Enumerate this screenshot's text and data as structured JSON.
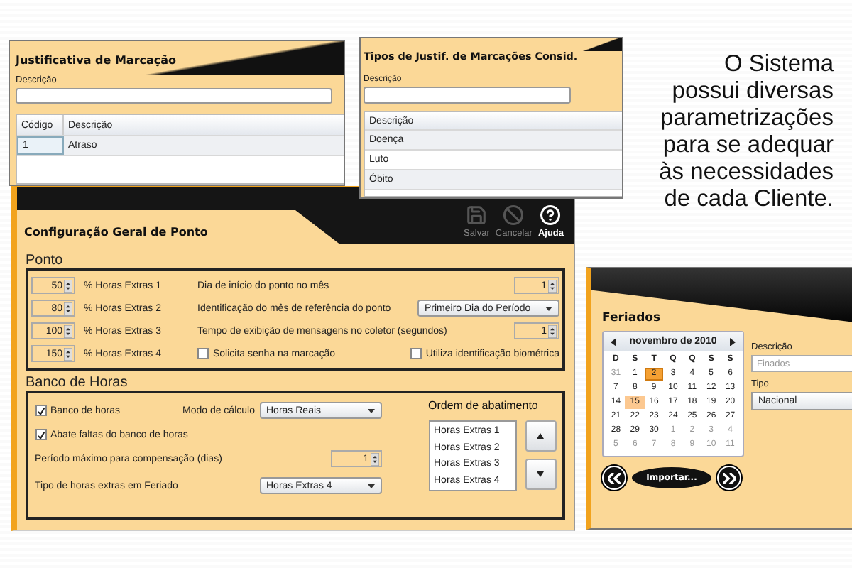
{
  "justificativa_window": {
    "title": "Justificativa de Marcação",
    "field_label": "Descrição",
    "table": {
      "columns": [
        "Código",
        "Descrição"
      ],
      "rows": [
        {
          "cells": [
            "1",
            "Atraso"
          ],
          "selected": true
        }
      ]
    }
  },
  "tipos_window": {
    "title": "Tipos de Justif. de Marcações Consid.",
    "field_label": "Descrição",
    "table": {
      "columns": [
        "Descrição"
      ],
      "rows": [
        {
          "cells": [
            "Doença"
          ]
        },
        {
          "cells": [
            "Luto"
          ]
        },
        {
          "cells": [
            "Óbito"
          ]
        }
      ]
    }
  },
  "slide_text": "O Sistema\npossui diversas\nparametrizações\npara se adequar\nàs necessidades\nde cada Cliente.",
  "config_window": {
    "title": "Configuração Geral de Ponto",
    "toolbar": [
      {
        "label": "Salvar",
        "disabled": true
      },
      {
        "label": "Cancelar",
        "disabled": true
      },
      {
        "label": "Ajuda",
        "disabled": false
      }
    ],
    "ponto": {
      "title": "Ponto",
      "rows": [
        {
          "percent": "50",
          "percent_label": "% Horas Extras 1",
          "setting": {
            "kind": "spinner",
            "label": "Dia de início do ponto no mês",
            "value": "1"
          }
        },
        {
          "percent": "80",
          "percent_label": "% Horas Extras 2",
          "setting": {
            "kind": "dropdown",
            "label": "Identificação do mês de referência do ponto",
            "value": "Primeiro Dia do Período"
          }
        },
        {
          "percent": "100",
          "percent_label": "% Horas Extras 3",
          "setting": {
            "kind": "spinner",
            "label": "Tempo de exibição de mensagens no coletor (segundos)",
            "value": "1"
          }
        },
        {
          "percent": "150",
          "percent_label": "% Horas Extras 4",
          "setting": {
            "kind": "checkboxes",
            "items": [
              {
                "label": "Solicita senha na marcação",
                "checked": false
              },
              {
                "label": "Utiliza identificação biométrica",
                "checked": false
              }
            ]
          }
        }
      ]
    },
    "banco": {
      "title": "Banco de Horas",
      "banco_check": {
        "label": "Banco de horas",
        "checked": true
      },
      "modo": {
        "label": "Modo de cálculo",
        "value": "Horas Reais"
      },
      "abate_check": {
        "label": "Abate faltas do banco de horas",
        "checked": true
      },
      "periodo": {
        "label": "Período máximo para compensação (dias)",
        "value": "1"
      },
      "tipo": {
        "label": "Tipo de horas extras em Feriado",
        "value": "Horas Extras 4"
      },
      "ordem": {
        "title": "Ordem de abatimento",
        "items": [
          "Horas Extras 1",
          "Horas Extras 2",
          "Horas Extras 3",
          "Horas Extras 4"
        ]
      }
    }
  },
  "feriados_window": {
    "title": "Feriados",
    "calendar": {
      "month": "novembro de 2010",
      "weekdays": [
        "D",
        "S",
        "T",
        "Q",
        "Q",
        "S",
        "S"
      ],
      "days": [
        {
          "label": "31",
          "other_month": true,
          "selected": false,
          "marked": false
        },
        {
          "label": "1",
          "other_month": false,
          "selected": false,
          "marked": false
        },
        {
          "label": "2",
          "other_month": false,
          "selected": true,
          "marked": false
        },
        {
          "label": "3",
          "other_month": false,
          "selected": false,
          "marked": false
        },
        {
          "label": "4",
          "other_month": false,
          "selected": false,
          "marked": false
        },
        {
          "label": "5",
          "other_month": false,
          "selected": false,
          "marked": false
        },
        {
          "label": "6",
          "other_month": false,
          "selected": false,
          "marked": false
        },
        {
          "label": "7",
          "other_month": false,
          "selected": false,
          "marked": false
        },
        {
          "label": "8",
          "other_month": false,
          "selected": false,
          "marked": false
        },
        {
          "label": "9",
          "other_month": false,
          "selected": false,
          "marked": false
        },
        {
          "label": "10",
          "other_month": false,
          "selected": false,
          "marked": false
        },
        {
          "label": "11",
          "other_month": false,
          "selected": false,
          "marked": false
        },
        {
          "label": "12",
          "other_month": false,
          "selected": false,
          "marked": false
        },
        {
          "label": "13",
          "other_month": false,
          "selected": false,
          "marked": false
        },
        {
          "label": "14",
          "other_month": false,
          "selected": false,
          "marked": false
        },
        {
          "label": "15",
          "other_month": false,
          "selected": false,
          "marked": true
        },
        {
          "label": "16",
          "other_month": false,
          "selected": false,
          "marked": false
        },
        {
          "label": "17",
          "other_month": false,
          "selected": false,
          "marked": false
        },
        {
          "label": "18",
          "other_month": false,
          "selected": false,
          "marked": false
        },
        {
          "label": "19",
          "other_month": false,
          "selected": false,
          "marked": false
        },
        {
          "label": "20",
          "other_month": false,
          "selected": false,
          "marked": false
        },
        {
          "label": "21",
          "other_month": false,
          "selected": false,
          "marked": false
        },
        {
          "label": "22",
          "other_month": false,
          "selected": false,
          "marked": false
        },
        {
          "label": "23",
          "other_month": false,
          "selected": false,
          "marked": false
        },
        {
          "label": "24",
          "other_month": false,
          "selected": false,
          "marked": false
        },
        {
          "label": "25",
          "other_month": false,
          "selected": false,
          "marked": false
        },
        {
          "label": "26",
          "other_month": false,
          "selected": false,
          "marked": false
        },
        {
          "label": "27",
          "other_month": false,
          "selected": false,
          "marked": false
        },
        {
          "label": "28",
          "other_month": false,
          "selected": false,
          "marked": false
        },
        {
          "label": "29",
          "other_month": false,
          "selected": false,
          "marked": false
        },
        {
          "label": "30",
          "other_month": false,
          "selected": false,
          "marked": false
        },
        {
          "label": "1",
          "other_month": true,
          "selected": false,
          "marked": false
        },
        {
          "label": "2",
          "other_month": true,
          "selected": false,
          "marked": false
        },
        {
          "label": "3",
          "other_month": true,
          "selected": false,
          "marked": false
        },
        {
          "label": "4",
          "other_month": true,
          "selected": false,
          "marked": false
        },
        {
          "label": "5",
          "other_month": true,
          "selected": false,
          "marked": false
        },
        {
          "label": "6",
          "other_month": true,
          "selected": false,
          "marked": false
        },
        {
          "label": "7",
          "other_month": true,
          "selected": false,
          "marked": false
        },
        {
          "label": "8",
          "other_month": true,
          "selected": false,
          "marked": false
        },
        {
          "label": "9",
          "other_month": true,
          "selected": false,
          "marked": false
        },
        {
          "label": "10",
          "other_month": true,
          "selected": false,
          "marked": false
        },
        {
          "label": "11",
          "other_month": true,
          "selected": false,
          "marked": false
        }
      ]
    },
    "import_button": "Importar...",
    "descricao": {
      "label": "Descrição",
      "placeholder": "Finados"
    },
    "tipo": {
      "label": "Tipo",
      "value": "Nacional"
    }
  }
}
